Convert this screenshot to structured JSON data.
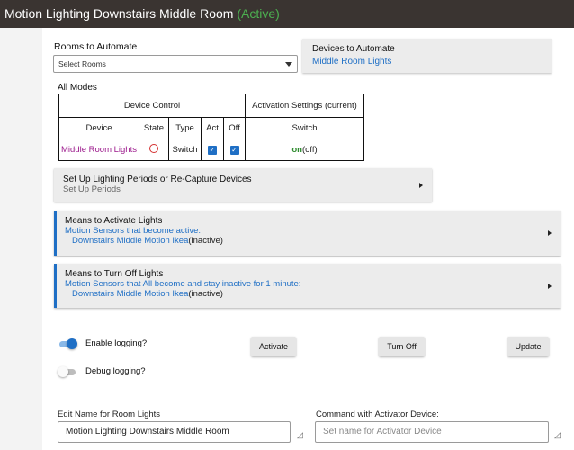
{
  "header": {
    "title": "Motion Lighting Downstairs Middle Room",
    "status": "(Active)"
  },
  "rooms": {
    "label": "Rooms to Automate",
    "value": "Select Rooms"
  },
  "devices": {
    "label": "Devices to Automate",
    "value": "Middle Room Lights"
  },
  "modes": {
    "label": "All Modes"
  },
  "device_table": {
    "group_device_control": "Device Control",
    "group_activation": "Activation Settings (current)",
    "col_device": "Device",
    "col_state": "State",
    "col_type": "Type",
    "col_act": "Act",
    "col_off": "Off",
    "col_switch": "Switch",
    "rows": [
      {
        "device": "Middle Room Lights",
        "type": "Switch",
        "switch_on": "on",
        "switch_off": "(off)"
      }
    ]
  },
  "periods_card": {
    "title": "Set Up Lighting Periods or Re-Capture Devices",
    "subtitle": "Set Up Periods"
  },
  "activate_card": {
    "title": "Means to Activate Lights",
    "line1": "Motion Sensors that become active:",
    "sensor": "Downstairs Middle Motion Ikea",
    "sensor_state": "(inactive)"
  },
  "turnoff_card": {
    "title": "Means to Turn Off Lights",
    "line1": "Motion Sensors that All become and stay inactive for 1 minute:",
    "sensor": "Downstairs Middle Motion Ikea",
    "sensor_state": "(inactive)"
  },
  "toggles": {
    "enable_logging": "Enable logging?",
    "debug_logging": "Debug logging?"
  },
  "buttons": {
    "activate": "Activate",
    "turn_off": "Turn Off",
    "update": "Update"
  },
  "name_field": {
    "label": "Edit Name for Room Lights",
    "value": "Motion Lighting Downstairs Middle Room"
  },
  "command_field": {
    "label": "Command with Activator Device:",
    "placeholder": "Set name for Activator Device"
  },
  "colors": {
    "accent": "#1f6fc5",
    "header_bg": "#3a3431",
    "active_status": "#4caf50",
    "on_state": "#2e8b2e",
    "device_link": "#9c1a8c",
    "off_indicator": "#d32f2f"
  }
}
